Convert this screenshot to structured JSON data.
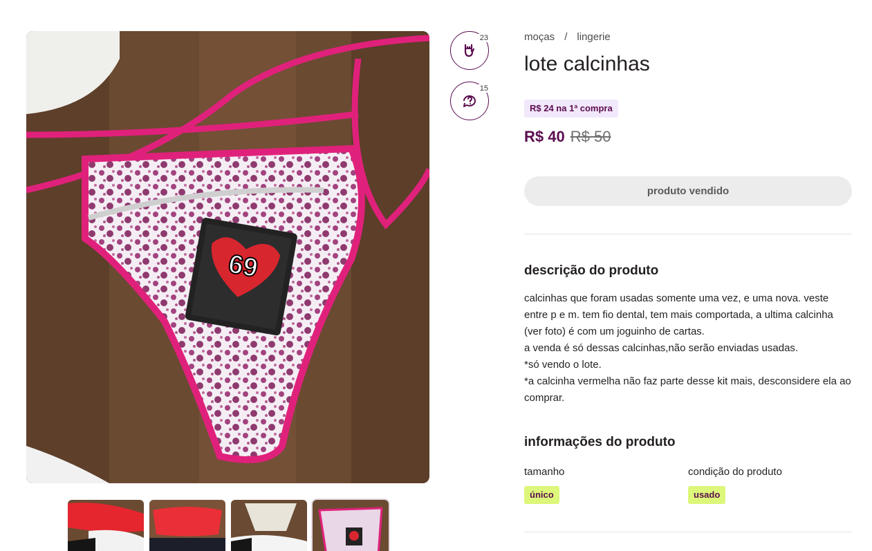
{
  "breadcrumb": {
    "items": [
      "moças",
      "lingerie"
    ],
    "separator": "/"
  },
  "product": {
    "title": "lote calcinhas",
    "promo": "R$ 24 na 1ª compra",
    "price": "R$ 40",
    "old_price": "R$ 50",
    "sold_label": "produto vendido"
  },
  "social": {
    "likes": "23",
    "questions": "15",
    "like_icon": "rock-hand-icon",
    "question_icon": "question-bubble-icon"
  },
  "description": {
    "heading": "descrição do produto",
    "lines": [
      "calcinhas que foram usadas somente uma vez, e uma nova. veste entre p e m. tem fio dental, tem mais comportada, a ultima calcinha (ver foto) é com um joguinho de cartas.",
      "a venda é só dessas calcinhas,não serão enviadas usadas.",
      "*só vendo o lote.",
      "*a calcinha vermelha não faz parte desse kit mais, desconsidere ela ao comprar."
    ]
  },
  "info": {
    "heading": "informações do produto",
    "attributes": [
      {
        "label": "tamanho",
        "value": "único"
      },
      {
        "label": "condição do produto",
        "value": "usado"
      }
    ]
  },
  "gallery": {
    "card_text": "69",
    "thumbnail_count": 4,
    "active_thumbnail": 4
  },
  "colors": {
    "brand": "#5b0d4f",
    "promo_bg": "#f2e8fb",
    "tag_bg": "#dcf779",
    "sold_bg": "#ececec"
  }
}
